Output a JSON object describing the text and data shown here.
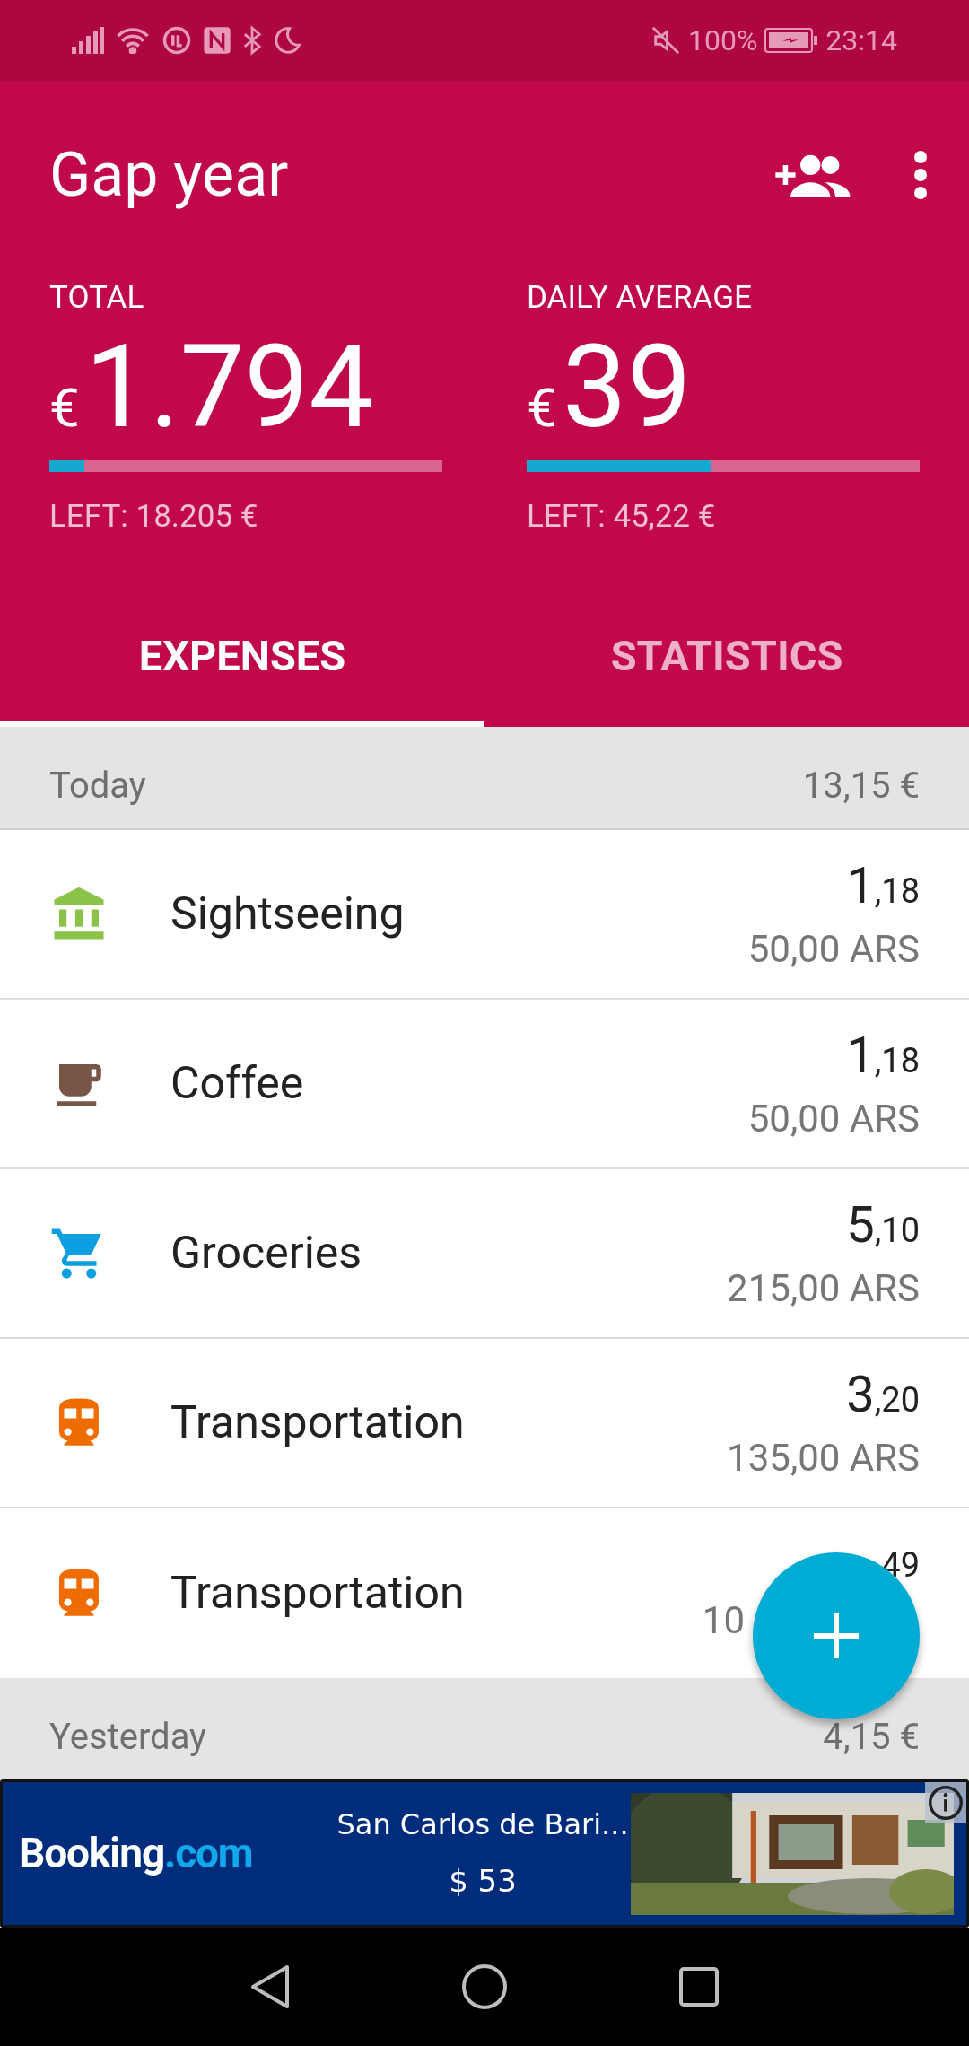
{
  "status_bar": {
    "battery": "100%",
    "time": "23:14"
  },
  "header": {
    "title": "Gap year"
  },
  "summary": [
    {
      "label": "TOTAL",
      "currency": "€",
      "amount": "1.794",
      "level": 0.09,
      "left": "LEFT: 18.205 €"
    },
    {
      "label": "DAILY AVERAGE",
      "currency": "€",
      "amount": "39",
      "level": 0.47,
      "left": "LEFT: 45,22 €"
    }
  ],
  "tabs": [
    {
      "label": "EXPENSES",
      "selected": true
    },
    {
      "label": "STATISTICS",
      "selected": false
    }
  ],
  "groups": [
    {
      "title": "Today",
      "total": "13,15 €",
      "expenses": [
        {
          "kind": "sightseeing",
          "color": "#8bc34a",
          "name": "Sightseeing",
          "amount": "1",
          "cents": ",18",
          "original": "50,00 ARS"
        },
        {
          "kind": "coffee",
          "color": "#795548",
          "name": "Coffee",
          "amount": "1",
          "cents": ",18",
          "original": "50,00 ARS"
        },
        {
          "kind": "groceries",
          "color": "#0b9ee0",
          "name": "Groceries",
          "amount": "5",
          "cents": ",10",
          "original": "215,00 ARS"
        },
        {
          "kind": "transport",
          "color": "#ef6c00",
          "name": "Transportation",
          "amount": "3",
          "cents": ",20",
          "original": "135,00 ARS"
        },
        {
          "kind": "transport",
          "color": "#ef6c00",
          "name": "Transportation",
          "cents": "49",
          "original": "10"
        }
      ]
    },
    {
      "title": "Yesterday",
      "total": "4,15 €"
    }
  ],
  "ad": {
    "logo_main": "Booking",
    "logo_suffix": ".com",
    "title": "San Carlos de Bari...",
    "price": "$ 53"
  }
}
